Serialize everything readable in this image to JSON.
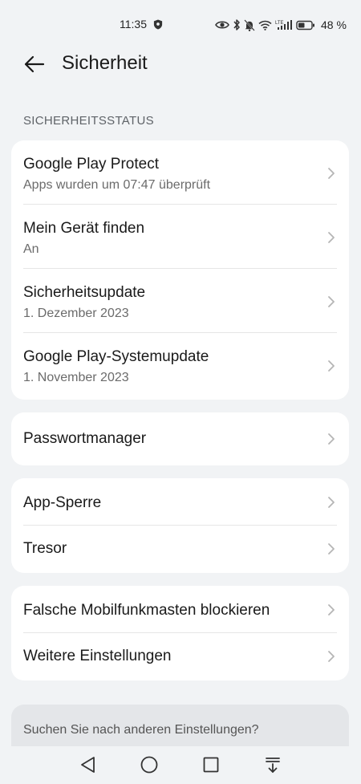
{
  "status_bar": {
    "time": "11:35",
    "battery_percent": "48 %",
    "icons": [
      "shield-icon",
      "eye-icon",
      "bluetooth-icon",
      "silent-icon",
      "wifi-icon",
      "lte-signal-icon",
      "battery-icon"
    ]
  },
  "header": {
    "title": "Sicherheit",
    "back_icon": "arrow-left-icon"
  },
  "section": {
    "label": "SICHERHEITSSTATUS"
  },
  "card1": {
    "items": [
      {
        "title": "Google Play Protect",
        "subtitle": "Apps wurden um 07:47 überprüft"
      },
      {
        "title": "Mein Gerät finden",
        "subtitle": "An"
      },
      {
        "title": "Sicherheitsupdate",
        "subtitle": "1. Dezember 2023"
      },
      {
        "title": "Google Play-Systemupdate",
        "subtitle": "1. November 2023"
      }
    ]
  },
  "card2": {
    "items": [
      {
        "title": "Passwortmanager"
      }
    ]
  },
  "card3": {
    "items": [
      {
        "title": "App-Sperre"
      },
      {
        "title": "Tresor"
      }
    ]
  },
  "card4": {
    "items": [
      {
        "title": "Falsche Mobilfunkmasten blockieren"
      },
      {
        "title": "Weitere Einstellungen"
      }
    ]
  },
  "search": {
    "placeholder": "Suchen Sie nach anderen Einstellungen?"
  },
  "navbar": {
    "icons": [
      "back-triangle-icon",
      "home-circle-icon",
      "recents-square-icon",
      "notification-pulldown-icon"
    ]
  },
  "colors": {
    "background": "#f1f3f5",
    "card": "#ffffff",
    "primary_text": "#1a1a1a",
    "secondary_text": "#6b6b6b",
    "section_label": "#5f6368",
    "chevron": "#b5b5b5"
  }
}
